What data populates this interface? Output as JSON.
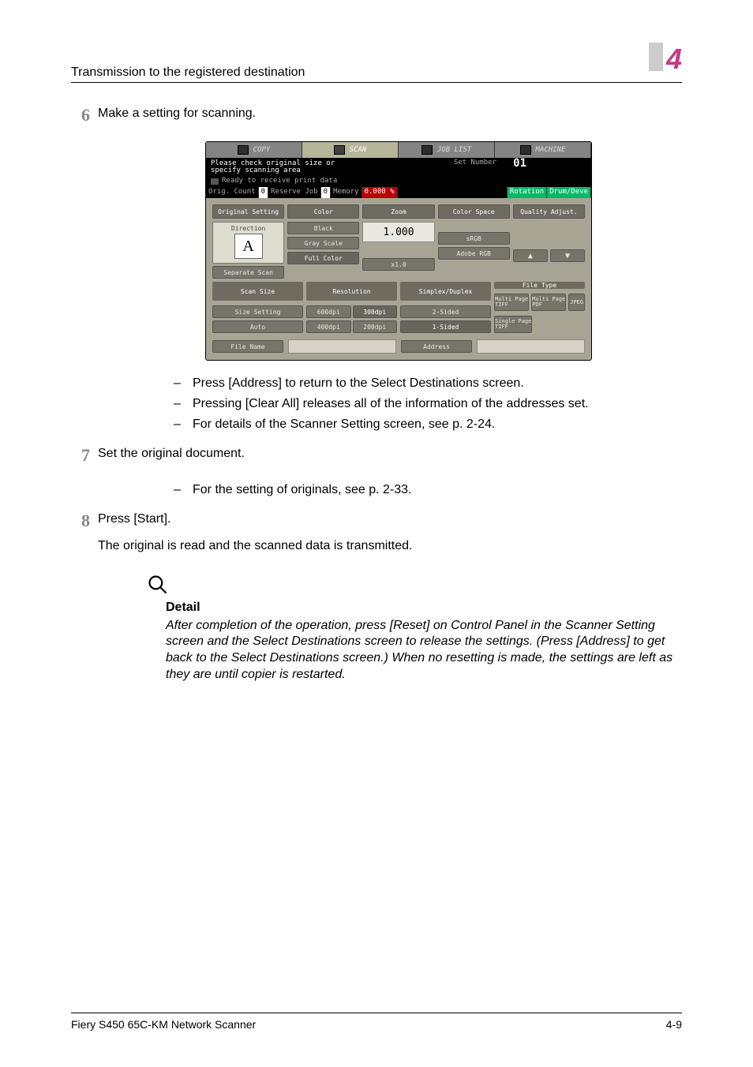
{
  "header": {
    "title": "Transmission to the registered destination",
    "chapter": "4"
  },
  "steps": {
    "s6": {
      "num": "6",
      "text": "Make a setting for scanning."
    },
    "s7": {
      "num": "7",
      "text": "Set the original document."
    },
    "s8": {
      "num": "8",
      "text": "Press [Start]."
    },
    "s8b": "The original is read and the scanned data is transmitted."
  },
  "bullets1": {
    "a": "Press [Address] to return to the Select Destinations screen.",
    "b": "Pressing [Clear All] releases all of the information of the addresses set.",
    "c": "For details of the Scanner Setting screen, see p. 2-24."
  },
  "bullets2": {
    "a": "For the setting of originals, see p. 2-33."
  },
  "detail": {
    "head": "Detail",
    "body": "After completion of the operation, press [Reset] on Control Panel in the Scanner Setting screen and the Select Destinations screen to release the settings. (Press [Address] to get back to the Select Destinations screen.) When no resetting is made, the settings are left as they are until copier is restarted."
  },
  "footer": {
    "left": "Fiery S450 65C-KM Network Scanner",
    "right": "4-9"
  },
  "device": {
    "tabs": {
      "copy": "COPY",
      "scan": "SCAN",
      "joblist": "JOB LIST",
      "machine": "MACHINE"
    },
    "msg": {
      "line1": "Please check original size or",
      "line2": "specify scanning area",
      "setnum_label": "Set Number",
      "setnum_val": "01",
      "ready": "Ready to receive print data"
    },
    "status": {
      "orig": "Orig. Count",
      "origv": "0",
      "res": "Reserve Job",
      "resv": "0",
      "mem": "Memory",
      "memv": "0.000 %",
      "rot": "Rotation",
      "drum": "Drum/Deve"
    },
    "row5": {
      "a": "Original Setting",
      "b": "Color",
      "c": "Zoom",
      "d": "Color Space",
      "e": "Quality Adjust."
    },
    "col1": {
      "dir": "Direction",
      "sep": "Separate Scan",
      "A": "A",
      "scan_size": "Scan Size",
      "size_setting": "Size Setting",
      "auto": "Auto",
      "file_name": "File Name"
    },
    "col2": {
      "black": "Black",
      "gray": "Gray Scale",
      "full": "Full Color",
      "reso": "Resolution",
      "r600": "600dpi",
      "r400": "400dpi",
      "r300": "300dpi",
      "r200": "200dpi"
    },
    "col3": {
      "zoom": "1.000",
      "x1": "x1.0",
      "sd": "Simplex/Duplex",
      "two": "2-Sided",
      "one": "1-Sided"
    },
    "col4": {
      "srgb": "sRGB",
      "adobe": "Adobe RGB",
      "mp_tiff": "Multi Page\nTIFF",
      "sp_tiff": "Single Page\nTIFF"
    },
    "col5": {
      "up": "▲",
      "dn": "▼",
      "mp_pdf": "Multi Page\nPDF",
      "jpeg": "JPEG"
    },
    "filetype": "File Type",
    "address": "Address"
  }
}
